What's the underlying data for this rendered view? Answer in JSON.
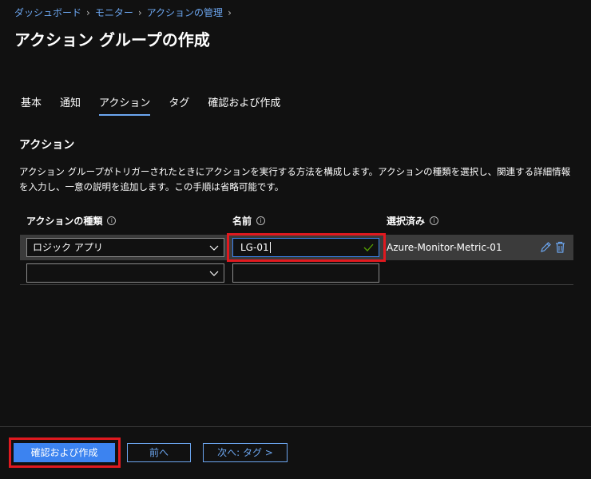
{
  "breadcrumb": {
    "items": [
      "ダッシュボード",
      "モニター",
      "アクションの管理"
    ]
  },
  "page": {
    "title": "アクション グループの作成"
  },
  "tabs": [
    {
      "label": "基本"
    },
    {
      "label": "通知"
    },
    {
      "label": "アクション",
      "active": true
    },
    {
      "label": "タグ"
    },
    {
      "label": "確認および作成"
    }
  ],
  "section": {
    "title": "アクション",
    "description": "アクション グループがトリガーされたときにアクションを実行する方法を構成します。アクションの種類を選択し、関連する詳細情報を入力し、一意の説明を追加します。この手順は省略可能です。"
  },
  "grid": {
    "headers": {
      "action_type": "アクションの種類",
      "name": "名前",
      "selected": "選択済み"
    },
    "rows": [
      {
        "action_type": "ロジック アプリ",
        "name": "LG-01",
        "selected": "Azure-Monitor-Metric-01"
      },
      {
        "action_type": "",
        "name": "",
        "selected": ""
      }
    ]
  },
  "footer": {
    "review_create": "確認および作成",
    "previous": "前へ",
    "next": "次へ: タグ >"
  },
  "colors": {
    "accent": "#3c83f0",
    "link": "#6ca6f0",
    "highlight": "#e0191f",
    "valid": "#57a300"
  }
}
